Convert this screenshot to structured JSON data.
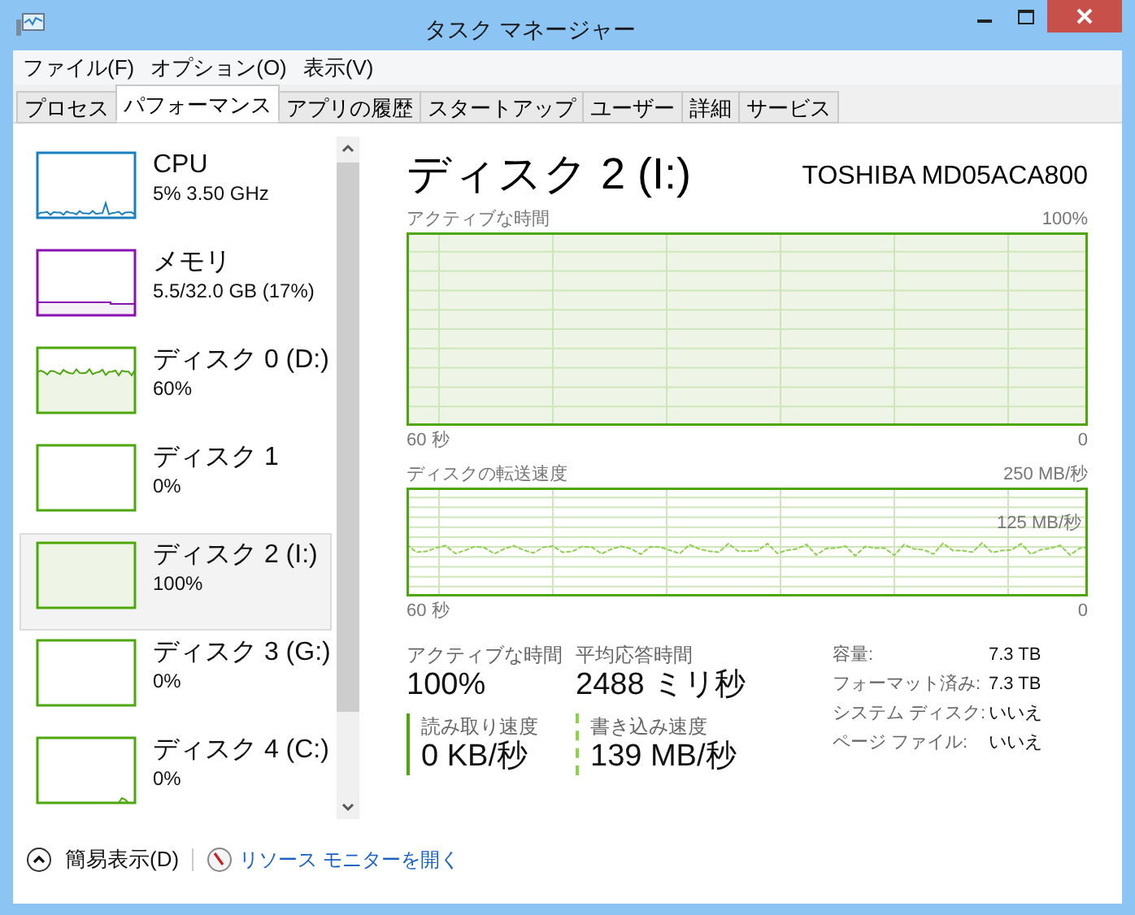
{
  "window": {
    "title": "タスク マネージャー"
  },
  "menu": [
    "ファイル(F)",
    "オプション(O)",
    "表示(V)"
  ],
  "tabs": [
    {
      "label": "プロセス",
      "selected": false
    },
    {
      "label": "パフォーマンス",
      "selected": true
    },
    {
      "label": "アプリの履歴",
      "selected": false
    },
    {
      "label": "スタートアップ",
      "selected": false
    },
    {
      "label": "ユーザー",
      "selected": false
    },
    {
      "label": "詳細",
      "selected": false
    },
    {
      "label": "サービス",
      "selected": false
    }
  ],
  "sidebar": {
    "items": [
      {
        "name": "CPU",
        "detail": "5% 3.50 GHz",
        "color": "#1a7fc1",
        "kind": "spiky",
        "selected": false
      },
      {
        "name": "メモリ",
        "detail": "5.5/32.0 GB (17%)",
        "color": "#8b12ae",
        "kind": "step",
        "selected": false
      },
      {
        "name": "ディスク 0 (D:)",
        "detail": "60%",
        "color": "#4da60c",
        "kind": "noisy",
        "selected": false
      },
      {
        "name": "ディスク 1",
        "detail": "0%",
        "color": "#4da60c",
        "kind": "empty",
        "selected": false
      },
      {
        "name": "ディスク 2 (I:)",
        "detail": "100%",
        "color": "#4da60c",
        "kind": "full",
        "selected": true
      },
      {
        "name": "ディスク 3 (G:)",
        "detail": "0%",
        "color": "#4da60c",
        "kind": "empty",
        "selected": false
      },
      {
        "name": "ディスク 4 (C:)",
        "detail": "0%",
        "color": "#4da60c",
        "kind": "blip",
        "selected": false
      }
    ]
  },
  "detail": {
    "title": "ディスク 2 (I:)",
    "model": "TOSHIBA MD05ACA800",
    "active_chart": {
      "label": "アクティブな時間",
      "max": "100%",
      "start": "60 秒",
      "end": "0"
    },
    "transfer_chart": {
      "label": "ディスクの転送速度",
      "max": "250 MB/秒",
      "mid": "125 MB/秒",
      "start": "60 秒",
      "end": "0"
    },
    "stats": [
      {
        "label": "アクティブな時間",
        "value": "100%",
        "kind": "plain"
      },
      {
        "label": "平均応答時間",
        "value": "2488 ミリ秒",
        "kind": "plain"
      },
      {
        "label": "読み取り速度",
        "value": "0 KB/秒",
        "kind": "read"
      },
      {
        "label": "書き込み速度",
        "value": "139 MB/秒",
        "kind": "write"
      }
    ],
    "properties": [
      {
        "label": "容量:",
        "value": "7.3 TB"
      },
      {
        "label": "フォーマット済み:",
        "value": "7.3 TB"
      },
      {
        "label": "システム ディスク:",
        "value": "いいえ"
      },
      {
        "label": "ページ ファイル:",
        "value": "いいえ"
      }
    ]
  },
  "footer": {
    "toggle": "簡易表示(D)",
    "link": "リソース モニターを開く"
  }
}
